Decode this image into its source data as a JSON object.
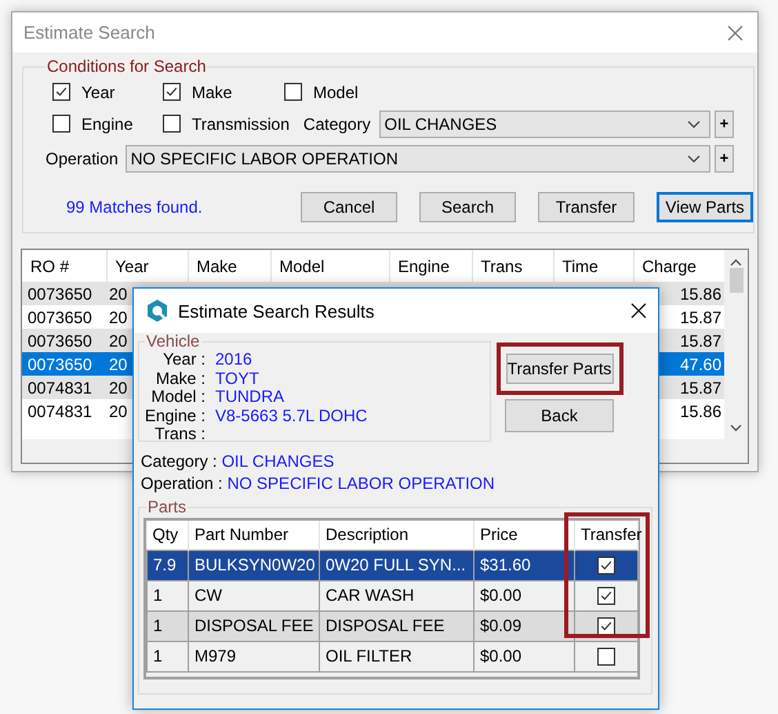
{
  "window": {
    "title": "Estimate Search"
  },
  "conditions": {
    "legend": "Conditions for Search",
    "checks": [
      {
        "label": "Year",
        "checked": true
      },
      {
        "label": "Make",
        "checked": true
      },
      {
        "label": "Model",
        "checked": false
      },
      {
        "label": "Engine",
        "checked": false
      },
      {
        "label": "Transmission",
        "checked": false
      }
    ],
    "category": {
      "label": "Category",
      "value": "OIL CHANGES",
      "add": "+"
    },
    "operation": {
      "label": "Operation",
      "value": "NO SPECIFIC LABOR OPERATION",
      "add": "+"
    }
  },
  "status": "99 Matches found.",
  "buttons": [
    {
      "label": "Cancel",
      "focused": false
    },
    {
      "label": "Search",
      "focused": false
    },
    {
      "label": "Transfer",
      "focused": false
    },
    {
      "label": "View Parts",
      "focused": true
    }
  ],
  "results_grid": {
    "columns": [
      "RO #",
      "Year",
      "Make",
      "Model",
      "Engine",
      "Trans",
      "Time",
      "Charge"
    ],
    "rows": [
      {
        "ro": "0073650",
        "year": "20",
        "charge": "15.86",
        "selected": false
      },
      {
        "ro": "0073650",
        "year": "20",
        "charge": "15.87",
        "selected": false
      },
      {
        "ro": "0073650",
        "year": "20",
        "charge": "15.87",
        "selected": false
      },
      {
        "ro": "0073650",
        "year": "20",
        "charge": "47.60",
        "selected": true
      },
      {
        "ro": "0074831",
        "year": "20",
        "charge": "15.87",
        "selected": false
      },
      {
        "ro": "0074831",
        "year": "20",
        "charge": "15.86",
        "selected": false
      }
    ]
  },
  "dialog": {
    "title": "Estimate Search Results",
    "vehicle": {
      "legend": "Vehicle",
      "fields": [
        {
          "label": "Year :",
          "value": "2016"
        },
        {
          "label": "Make :",
          "value": "TOYT"
        },
        {
          "label": "Model :",
          "value": "TUNDRA"
        },
        {
          "label": "Engine :",
          "value": "V8-5663 5.7L DOHC"
        },
        {
          "label": "Trans :"
        }
      ]
    },
    "buttons": [
      {
        "label": "Transfer Parts",
        "highlighted": true
      },
      {
        "label": "Back",
        "highlighted": false
      }
    ],
    "category": {
      "label": "Category :",
      "value": "OIL CHANGES"
    },
    "operation": {
      "label": "Operation :",
      "value": "NO SPECIFIC LABOR OPERATION"
    },
    "parts": {
      "legend": "Parts",
      "columns": [
        "Qty",
        "Part Number",
        "Description",
        "Price",
        "Transfer"
      ],
      "transfer_column_highlighted": true,
      "rows": [
        {
          "qty": "7.9",
          "part_number": "BULKSYN0W20",
          "description": "0W20 FULL SYN...",
          "price": "$31.60",
          "transfer": true,
          "selected": true
        },
        {
          "qty": "1",
          "part_number": "CW",
          "description": "CAR WASH",
          "price": "$0.00",
          "transfer": true,
          "selected": false
        },
        {
          "qty": "1",
          "part_number": "DISPOSAL FEE",
          "description": "DISPOSAL FEE",
          "price": "$0.09",
          "transfer": true,
          "selected": false
        },
        {
          "qty": "1",
          "part_number": "M979",
          "description": "OIL FILTER",
          "price": "$0.00",
          "transfer": false,
          "selected": false
        }
      ]
    }
  }
}
